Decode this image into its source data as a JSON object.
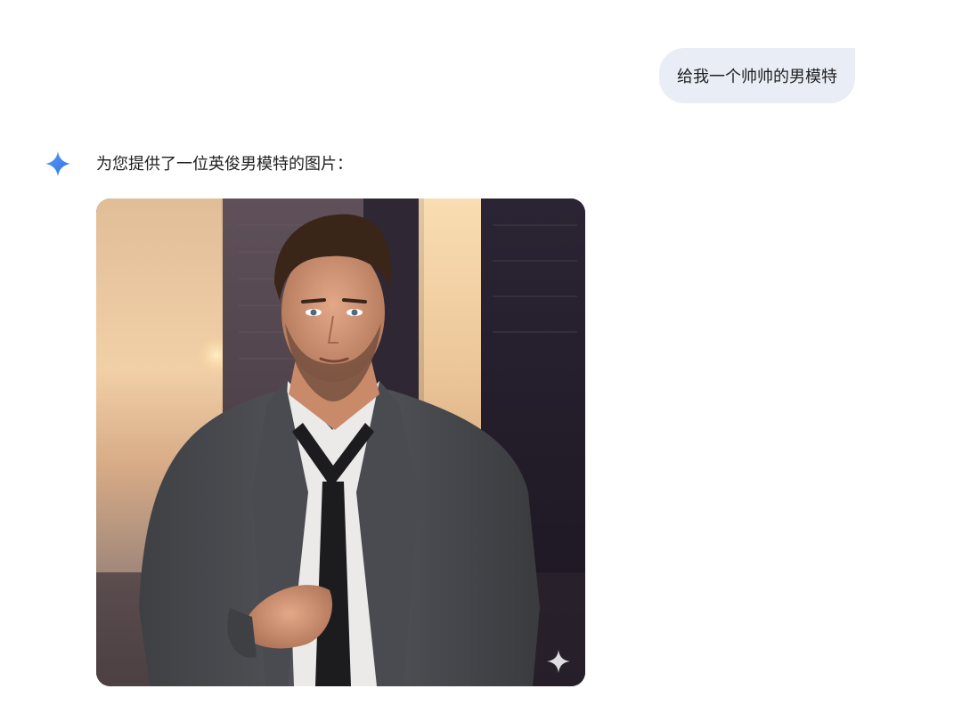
{
  "conversation": {
    "user_message": "给我一个帅帅的男模特",
    "model_response": {
      "icon": "gemini-sparkle-icon",
      "text": "为您提供了一位英俊男模特的图片：",
      "image": {
        "subject": "man-in-grey-suit-portrait",
        "watermark_icon": "sparkle-watermark-icon"
      }
    }
  },
  "colors": {
    "user_bubble_bg": "#e9eef6",
    "gemini_blue": "#4285f4",
    "text": "#1f1f1f"
  }
}
